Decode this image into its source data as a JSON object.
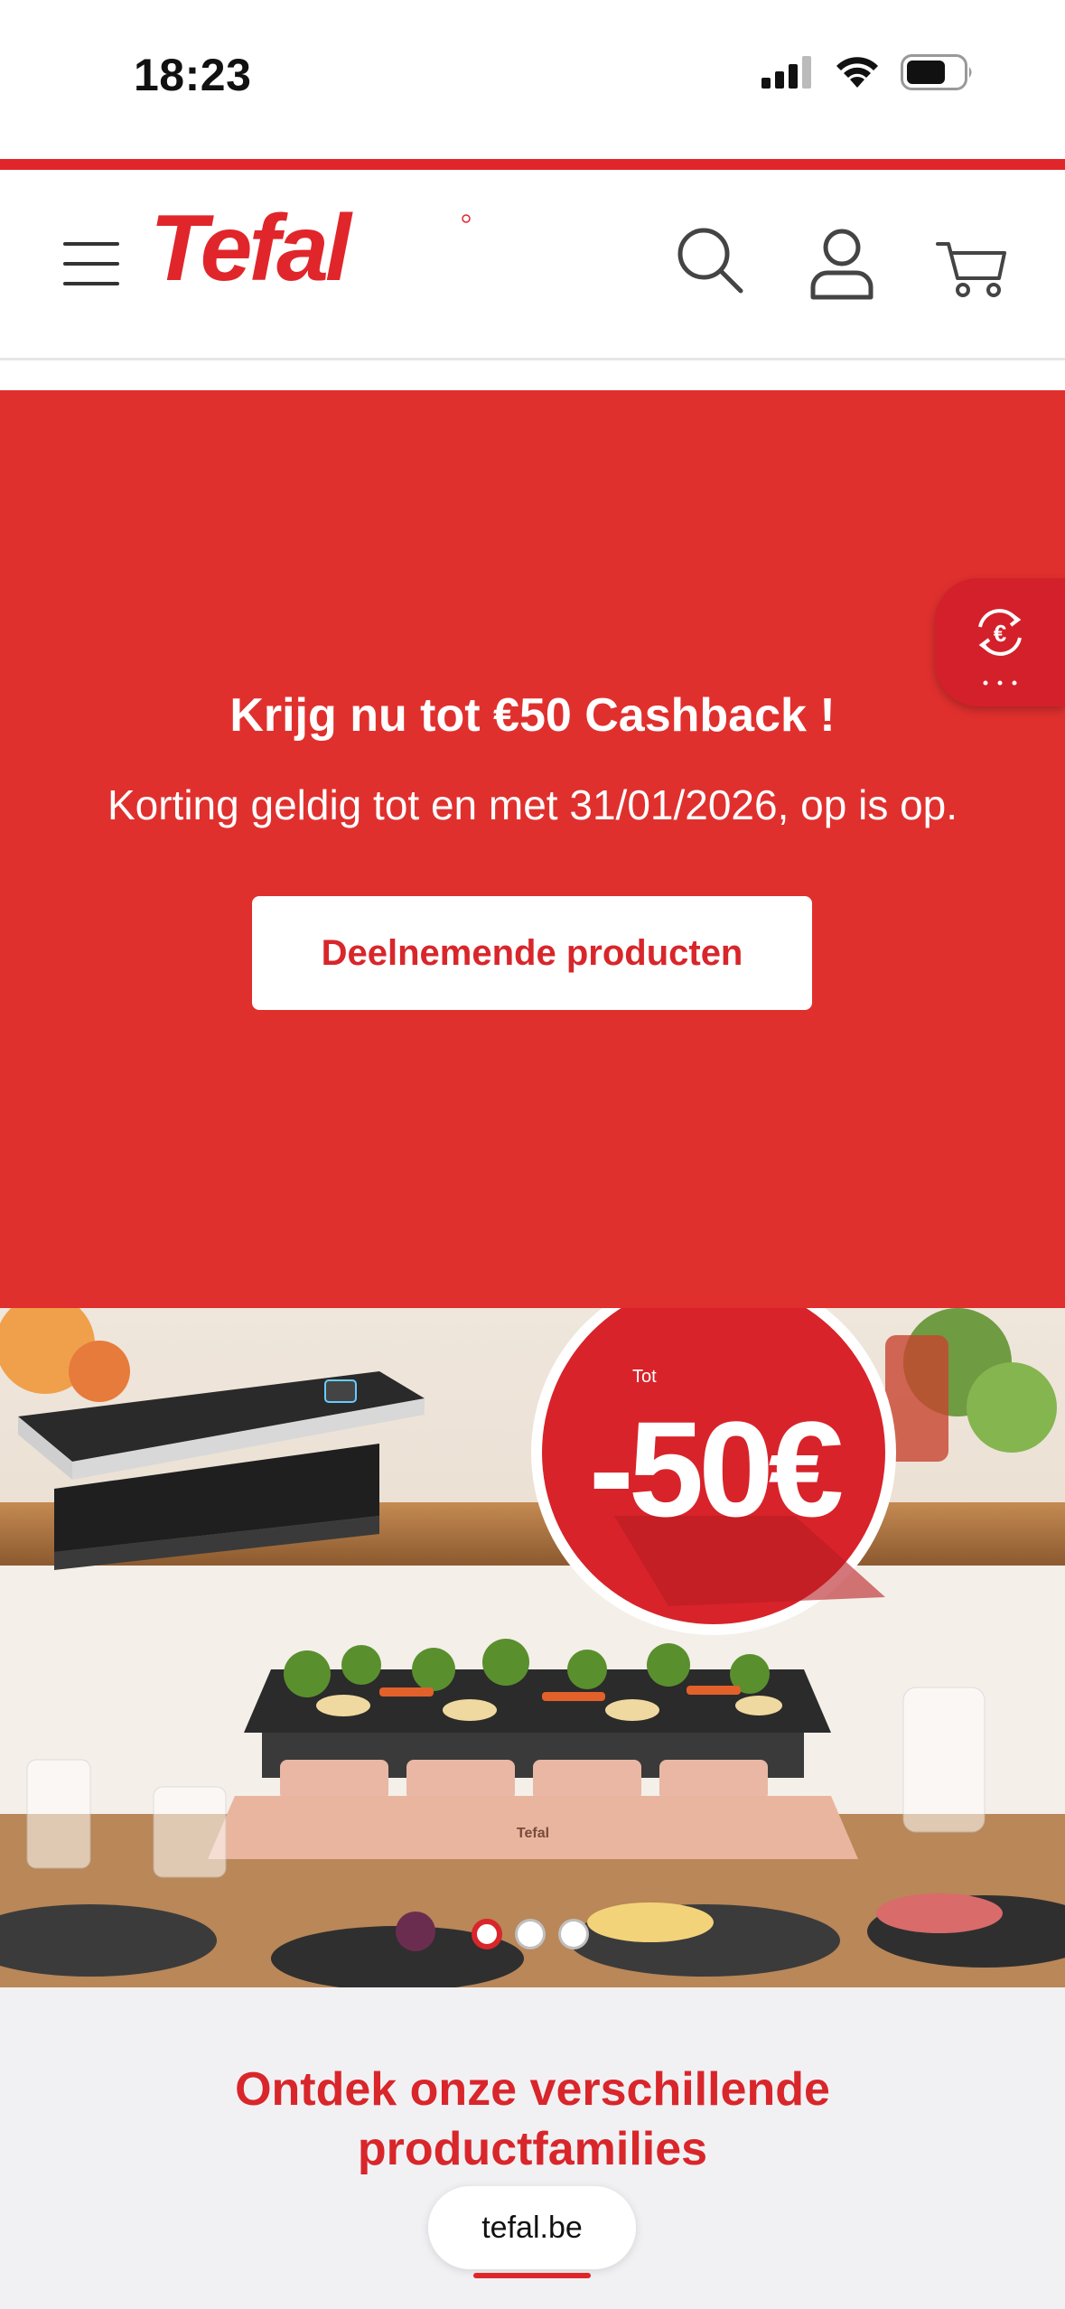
{
  "status_bar": {
    "time": "18:23"
  },
  "header": {
    "brand": "Tefal",
    "icons": [
      "menu-icon",
      "search-icon",
      "account-icon",
      "cart-icon"
    ]
  },
  "hero": {
    "title": "Krijg nu tot €50 Cashback !",
    "subtitle": "Korting geldig tot en met 31/01/2026, op is op.",
    "button_label": "Deelnemende producten",
    "background_color": "#e0302e"
  },
  "cashback_tab": {
    "icon": "euro-cycle-icon"
  },
  "banner": {
    "badge_prefix": "Tot",
    "badge_value": "-50€",
    "product_brand": "Tefal",
    "slides_total": 3,
    "active_slide": 1
  },
  "section": {
    "title": "Ontdek onze verschillende productfamilies"
  },
  "browser": {
    "url": "tefal.be"
  },
  "colors": {
    "brand_red": "#d8262b"
  }
}
